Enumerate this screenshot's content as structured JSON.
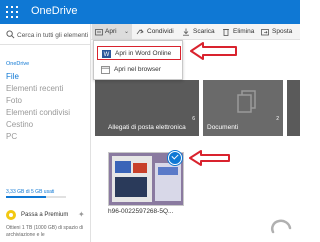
{
  "app": {
    "name": "OneDrive"
  },
  "nav": {
    "search_placeholder": "Cerca in tutti gli elementi",
    "section": "OneDrive",
    "items": [
      {
        "label": "File",
        "active": true
      },
      {
        "label": "Elementi recenti",
        "active": false
      },
      {
        "label": "Foto",
        "active": false
      },
      {
        "label": "Elementi condivisi",
        "active": false
      },
      {
        "label": "Cestino",
        "active": false
      },
      {
        "label": "PC",
        "active": false
      }
    ],
    "storage_text": "3,33 GB di 5 GB usati",
    "storage_fraction": 0.67,
    "premium_label": "Passa a Premium",
    "promo_text": "Ottieni 1 TB (1000 GB) di spazio di archiviazione e le"
  },
  "commands": [
    {
      "label": "Apri",
      "icon": "open-icon"
    },
    {
      "label": "Condividi",
      "icon": "share-icon"
    },
    {
      "label": "Scarica",
      "icon": "download-icon"
    },
    {
      "label": "Elimina",
      "icon": "delete-icon"
    },
    {
      "label": "Sposta",
      "icon": "move-icon"
    }
  ],
  "dropdown": {
    "word_label": "Apri in Word Online",
    "browser_label": "Apri nel browser"
  },
  "tiles": [
    {
      "label": "Allegati di posta elettronica",
      "count": "6"
    },
    {
      "label": "Documenti",
      "count": "2"
    }
  ],
  "file": {
    "caption": "h96-0022597268-5Q..."
  },
  "colors": {
    "accent": "#0f78d4",
    "highlight": "#d9232e"
  }
}
